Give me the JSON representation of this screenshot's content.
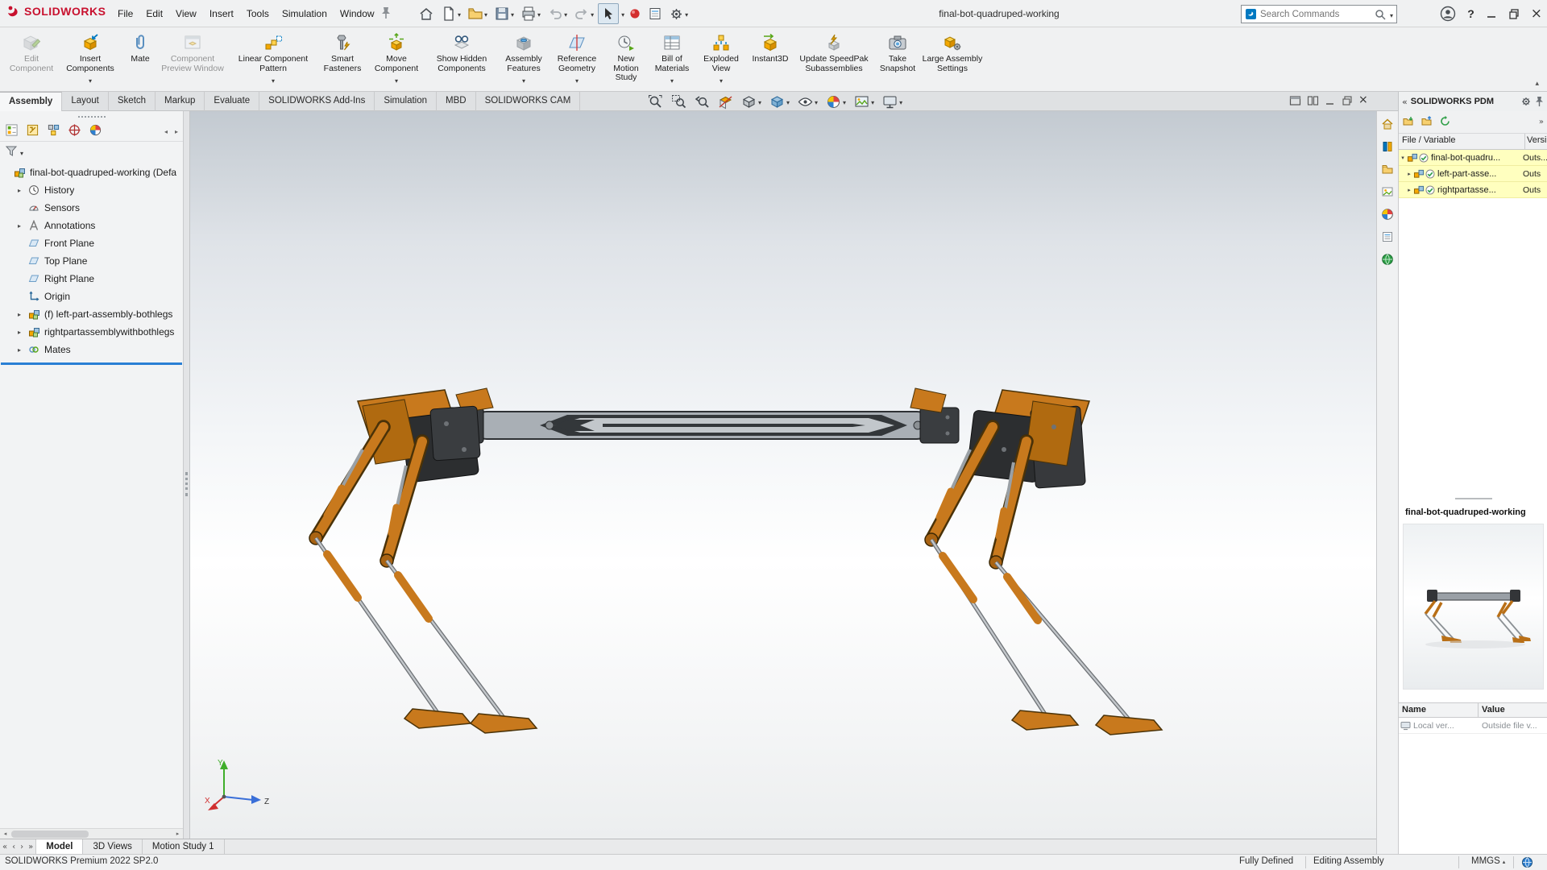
{
  "window": {
    "brand": "SOLIDWORKS",
    "document_title": "final-bot-quadruped-working",
    "search_placeholder": "Search Commands"
  },
  "menus": [
    "File",
    "Edit",
    "View",
    "Insert",
    "Tools",
    "Simulation",
    "Window"
  ],
  "quick_access": {
    "icons": [
      "home-icon",
      "new-document-icon",
      "open-icon",
      "save-icon",
      "print-icon",
      "undo-icon",
      "redo-icon",
      "select-arrow-icon",
      "record-sphere-icon",
      "command-list-icon",
      "options-gear-icon"
    ]
  },
  "ribbon": {
    "buttons": [
      {
        "label": "Edit Component",
        "icon": "edit-component-icon",
        "disabled": true,
        "dropdown": false
      },
      {
        "label": "Insert Components",
        "icon": "insert-components-icon",
        "disabled": false,
        "dropdown": true
      },
      {
        "label": "Mate",
        "icon": "mate-icon",
        "disabled": false,
        "dropdown": false
      },
      {
        "label": "Component Preview Window",
        "icon": "component-preview-window-icon",
        "disabled": true,
        "dropdown": false
      },
      {
        "label": "Linear Component Pattern",
        "icon": "linear-component-pattern-icon",
        "disabled": false,
        "dropdown": true
      },
      {
        "label": "Smart Fasteners",
        "icon": "smart-fasteners-icon",
        "disabled": false,
        "dropdown": false
      },
      {
        "label": "Move Component",
        "icon": "move-component-icon",
        "disabled": false,
        "dropdown": true
      },
      {
        "label": "Show Hidden Components",
        "icon": "show-hidden-components-icon",
        "disabled": false,
        "dropdown": false
      },
      {
        "label": "Assembly Features",
        "icon": "assembly-features-icon",
        "disabled": false,
        "dropdown": true
      },
      {
        "label": "Reference Geometry",
        "icon": "reference-geometry-icon",
        "disabled": false,
        "dropdown": true
      },
      {
        "label": "New Motion Study",
        "icon": "new-motion-study-icon",
        "disabled": false,
        "dropdown": false
      },
      {
        "label": "Bill of Materials",
        "icon": "bill-of-materials-icon",
        "disabled": false,
        "dropdown": true
      },
      {
        "label": "Exploded View",
        "icon": "exploded-view-icon",
        "disabled": false,
        "dropdown": true
      },
      {
        "label": "Instant3D",
        "icon": "instant3d-icon",
        "disabled": false,
        "dropdown": false
      },
      {
        "label": "Update SpeedPak Subassemblies",
        "icon": "update-speedpak-icon",
        "disabled": false,
        "dropdown": false
      },
      {
        "label": "Take Snapshot",
        "icon": "take-snapshot-icon",
        "disabled": false,
        "dropdown": false
      },
      {
        "label": "Large Assembly Settings",
        "icon": "large-assembly-settings-icon",
        "disabled": false,
        "dropdown": false
      }
    ]
  },
  "command_tabs": {
    "active": "Assembly",
    "items": [
      "Assembly",
      "Layout",
      "Sketch",
      "Markup",
      "Evaluate",
      "SOLIDWORKS Add-Ins",
      "Simulation",
      "MBD",
      "SOLIDWORKS CAM"
    ]
  },
  "hud": {
    "icons": [
      "zoom-to-fit-icon",
      "zoom-to-area-icon",
      "previous-view-icon",
      "section-view-icon",
      "view-orientation-icon",
      "display-style-icon",
      "hide-show-items-icon",
      "edit-appearance-icon",
      "apply-scene-icon",
      "view-settings-icon"
    ]
  },
  "feature_panel": {
    "tab_icons": [
      "featuremanager-tab-icon",
      "propertymanager-tab-icon",
      "configurationmanager-tab-icon",
      "dimxpertmanager-tab-icon",
      "displaymanager-tab-icon"
    ],
    "root_label": "final-bot-quadruped-working (Defa",
    "items": [
      {
        "label": "History",
        "icon": "history-icon",
        "expandable": true
      },
      {
        "label": "Sensors",
        "icon": "sensors-icon",
        "expandable": false
      },
      {
        "label": "Annotations",
        "icon": "annotations-icon",
        "expandable": true
      },
      {
        "label": "Front Plane",
        "icon": "plane-icon",
        "expandable": false
      },
      {
        "label": "Top Plane",
        "icon": "plane-icon",
        "expandable": false
      },
      {
        "label": "Right Plane",
        "icon": "plane-icon",
        "expandable": false
      },
      {
        "label": "Origin",
        "icon": "origin-icon",
        "expandable": false
      },
      {
        "label": "(f) left-part-assembly-bothlegs",
        "icon": "assembly-icon",
        "expandable": true
      },
      {
        "label": "rightpartassemblywithbothlegs",
        "icon": "assembly-icon",
        "expandable": true
      },
      {
        "label": "Mates",
        "icon": "mates-icon",
        "expandable": true
      }
    ]
  },
  "viewport": {
    "triad": {
      "x": "X",
      "y": "Y",
      "z": "Z"
    }
  },
  "task_pane": {
    "title": "SOLIDWORKS PDM",
    "strip_icons": [
      "home-icon",
      "design-library-icon",
      "file-explorer-icon",
      "view-palette-icon",
      "appearances-icon",
      "custom-properties-icon",
      "pdm-vault-icon"
    ],
    "columns": {
      "file": "File / Variable",
      "version": "Versi"
    },
    "rows": [
      {
        "name": "final-bot-quadru...",
        "version": "Outs...",
        "expanded": true
      },
      {
        "name": "left-part-asse...",
        "version": "Outs",
        "expanded": false
      },
      {
        "name": "rightpartasse...",
        "version": "Outs",
        "expanded": false
      }
    ],
    "preview_title": "final-bot-quadruped-working",
    "properties": {
      "name_header": "Name",
      "value_header": "Value",
      "rows": [
        {
          "name": "Local ver...",
          "value": "Outside file v..."
        }
      ]
    }
  },
  "document_tabs": {
    "active": "Model",
    "items": [
      "Model",
      "3D Views",
      "Motion Study 1"
    ]
  },
  "status_bar": {
    "product": "SOLIDWORKS Premium 2022 SP2.0",
    "definition_state": "Fully Defined",
    "mode": "Editing Assembly",
    "units": "MMGS"
  },
  "colors": {
    "brand_red": "#c8102e",
    "accent_gold": "#f5a800",
    "accent_blue": "#0079c1",
    "accent_green": "#58a618",
    "rollback_blue": "#2a7fd4",
    "pdm_row_highlight": "#ffffbf",
    "robot_orange": "#c8791d"
  }
}
